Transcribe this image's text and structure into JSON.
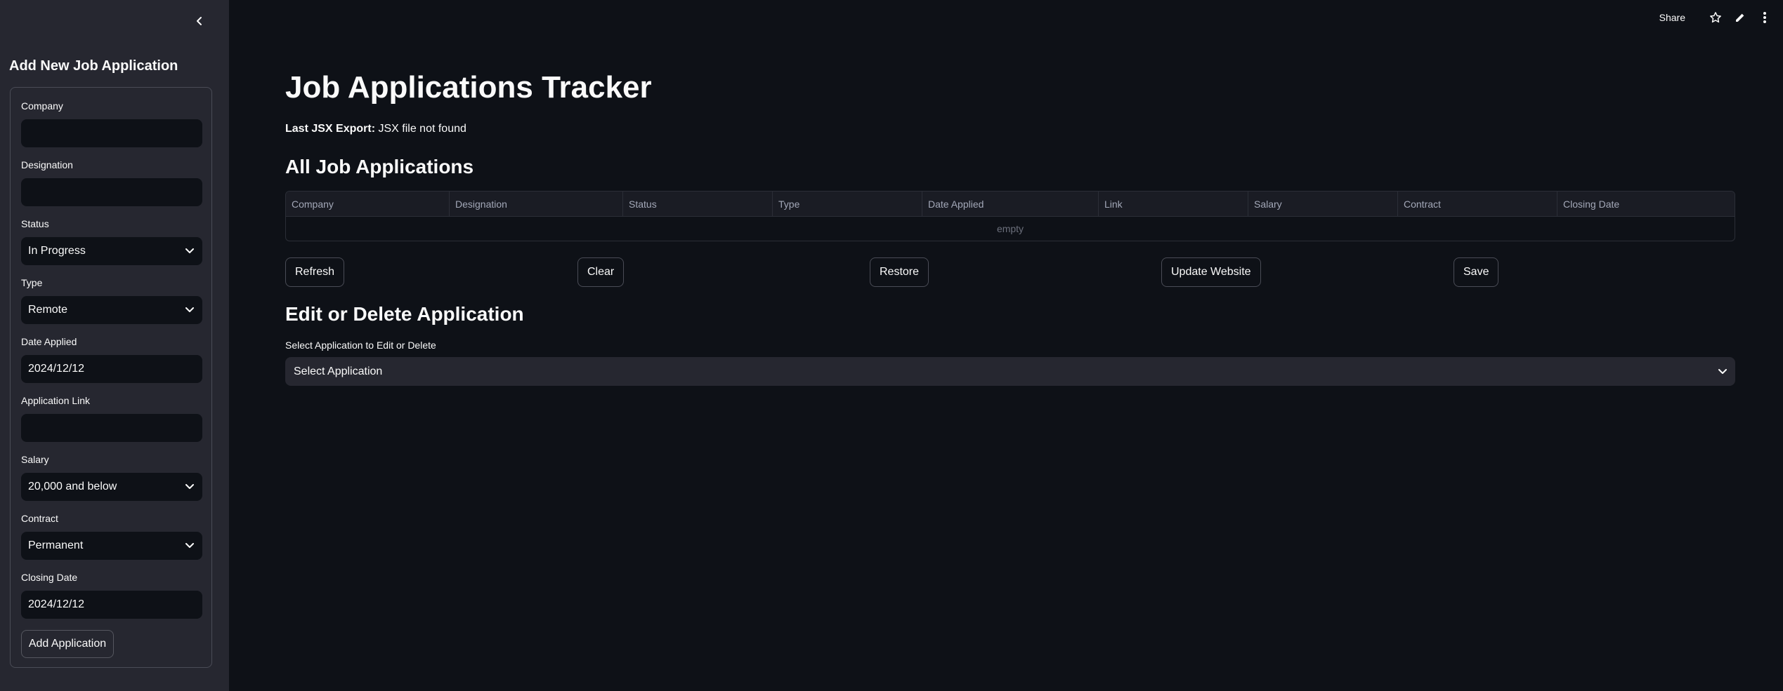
{
  "sidebar": {
    "collapse_icon": "chevron-left-icon",
    "title": "Add New Job Application",
    "fields": {
      "company": {
        "label": "Company",
        "value": ""
      },
      "designation": {
        "label": "Designation",
        "value": ""
      },
      "status": {
        "label": "Status",
        "value": "In Progress"
      },
      "type": {
        "label": "Type",
        "value": "Remote"
      },
      "date_applied": {
        "label": "Date Applied",
        "value": "2024/12/12"
      },
      "application_link": {
        "label": "Application Link",
        "value": ""
      },
      "salary": {
        "label": "Salary",
        "value": "20,000 and below"
      },
      "contract": {
        "label": "Contract",
        "value": "Permanent"
      },
      "closing_date": {
        "label": "Closing Date",
        "value": "2024/12/12"
      }
    },
    "add_button": "Add Application"
  },
  "toolbar": {
    "share": "Share",
    "icons": [
      "star-icon",
      "pencil-icon",
      "kebab-menu-icon"
    ]
  },
  "main": {
    "title": "Job Applications Tracker",
    "export": {
      "label": "Last JSX Export:",
      "value": "JSX file not found"
    },
    "table_section_title": "All Job Applications",
    "table": {
      "columns": [
        "Company",
        "Designation",
        "Status",
        "Type",
        "Date Applied",
        "Link",
        "Salary",
        "Contract",
        "Closing Date"
      ],
      "empty_text": "empty"
    },
    "buttons": {
      "refresh": "Refresh",
      "clear": "Clear",
      "restore": "Restore",
      "update_website": "Update Website",
      "save": "Save"
    },
    "edit_section_title": "Edit or Delete Application",
    "select_label": "Select Application to Edit or Delete",
    "select_value": "Select Application"
  },
  "colors": {
    "background": "#0e1117",
    "sidebar": "#262730",
    "text": "#fafafa"
  }
}
